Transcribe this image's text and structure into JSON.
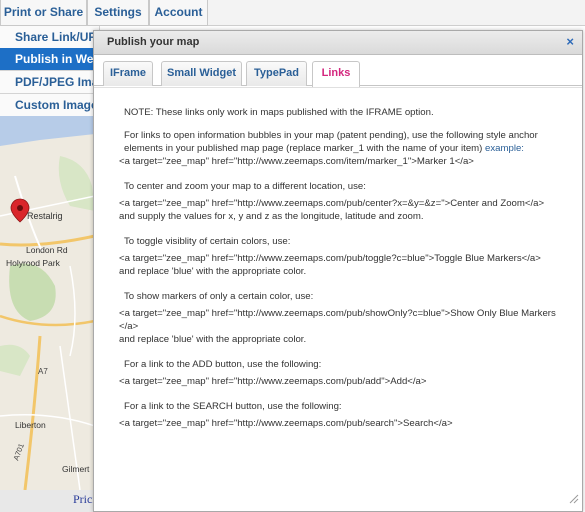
{
  "top_tabs": [
    "Print or Share",
    "Settings",
    "Account"
  ],
  "left_menu": [
    "Share Link/URL",
    "Publish in Webs",
    "PDF/JPEG Image",
    "Custom Image"
  ],
  "map": {
    "labels": [
      "Restalrig",
      "London Rd",
      "Holyrood Park",
      "A7",
      "Liberton",
      "A701",
      "Gilmert"
    ],
    "marker_color": "#d9262b"
  },
  "pricing_link": "Prici",
  "dialog": {
    "title": "Publish your map",
    "close": "×",
    "tabs": [
      "IFrame",
      "Small Widget",
      "TypePad",
      "Links"
    ],
    "active_tab": "Links",
    "active_tab_color": "#d4267e",
    "note": "NOTE: These links only work in maps published with the IFRAME option.",
    "intro_text": "For links to open information bubbles in your map (patent pending), use the following style anchor elements in your published map page (replace marker_1 with the name of your item)",
    "intro_link": "example:",
    "code_marker": "<a target=\"zee_map\" href=\"http://www.zeemaps.com/item/marker_1\">Marker 1</a>",
    "center_heading": "To center and zoom your map to a different location, use:",
    "code_center": "<a target=\"zee_map\" href=\"http://www.zeemaps.com/pub/center?x=&y=&z=\">Center and Zoom</a>",
    "center_after": "and supply the values for x, y and z as the longitude, latitude and zoom.",
    "toggle_heading": "To toggle visiblity of certain colors, use:",
    "code_toggle": "<a target=\"zee_map\" href=\"http://www.zeemaps.com/pub/toggle?c=blue\">Toggle Blue Markers</a>",
    "toggle_after": "and replace 'blue' with the appropriate color.",
    "show_heading": "To show markers of only a certain color, use:",
    "code_show": "<a target=\"zee_map\" href=\"http://www.zeemaps.com/pub/showOnly?c=blue\">Show Only Blue Markers</a>",
    "show_after": "and replace 'blue' with the appropriate color.",
    "add_heading": "For a link to the ADD button, use the following:",
    "code_add": "<a target=\"zee_map\" href=\"http://www.zeemaps.com/pub/add\">Add</a>",
    "search_heading": "For a link to the SEARCH button, use the following:",
    "code_search": "<a target=\"zee_map\" href=\"http://www.zeemaps.com/pub/search\">Search</a>"
  }
}
